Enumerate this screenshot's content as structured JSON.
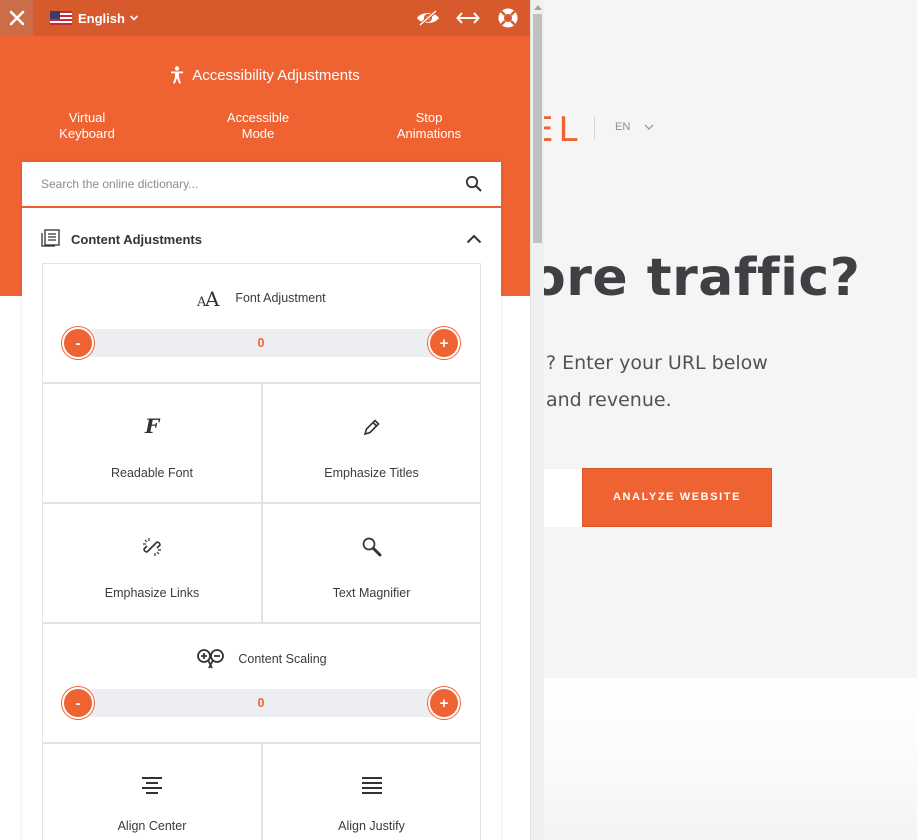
{
  "panel": {
    "language": "English",
    "header": {
      "title": "Accessibility Adjustments",
      "buttons": [
        {
          "label": "Virtual\nKeyboard"
        },
        {
          "label": "Accessible\nMode"
        },
        {
          "label": "Stop\nAnimations"
        }
      ]
    },
    "search": {
      "placeholder": "Search the online dictionary..."
    },
    "section": {
      "title": "Content Adjustments",
      "font_adjustment": {
        "label": "Font Adjustment",
        "value": "0",
        "dec": "-",
        "inc": "+"
      },
      "tiles_row1": [
        {
          "label": "Readable Font",
          "icon": "readable-font-icon"
        },
        {
          "label": "Emphasize Titles",
          "icon": "pen-icon"
        }
      ],
      "tiles_row2": [
        {
          "label": "Emphasize Links",
          "icon": "broken-link-icon"
        },
        {
          "label": "Text Magnifier",
          "icon": "magnifier-icon"
        }
      ],
      "content_scaling": {
        "label": "Content Scaling",
        "value": "0",
        "dec": "-",
        "inc": "+"
      },
      "tiles_row3": [
        {
          "label": "Align Center",
          "icon": "align-center-icon"
        },
        {
          "label": "Align Justify",
          "icon": "align-justify-icon"
        }
      ]
    }
  },
  "site": {
    "logo_fragment": "EL",
    "language": "EN",
    "headline": "ore traffic?",
    "subtext_line1": "? Enter your URL below",
    "subtext_line2": "and revenue.",
    "cta": "ANALYZE WEBSITE"
  },
  "colors": {
    "accent": "#ef6333",
    "topbar": "#d75a2d",
    "text": "#3b3b3b"
  }
}
